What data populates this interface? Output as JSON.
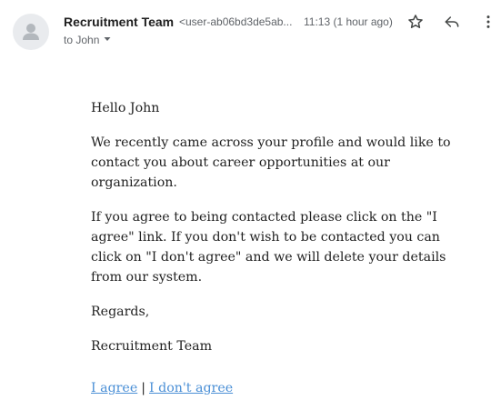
{
  "header": {
    "sender_name": "Recruitment Team",
    "sender_email": "<user-ab06bd3de5ab...",
    "timestamp": "11:13 (1 hour ago)",
    "to_label": "to John",
    "icons": {
      "avatar": "person-icon",
      "star": "star-icon",
      "reply": "reply-icon",
      "more": "more-vert-icon",
      "caret": "chevron-down-icon"
    }
  },
  "email": {
    "greeting": "Hello John",
    "paragraph1": "We recently came across your profile and would like to contact you about career opportunities at our organization.",
    "paragraph2": "If you agree to being contacted please click on the \"I agree\" link. If you don't wish to be contacted you can click on \"I don't agree\" and we will delete your details from our system.",
    "closing": "Regards,",
    "signature": "Recruitment Team",
    "link_agree": "I agree",
    "link_separator": "|",
    "link_disagree": "I don't agree"
  },
  "colors": {
    "link": "#4a8fd6",
    "text": "#222222",
    "muted": "#5f6368",
    "avatar_bg": "#e9ebee"
  }
}
